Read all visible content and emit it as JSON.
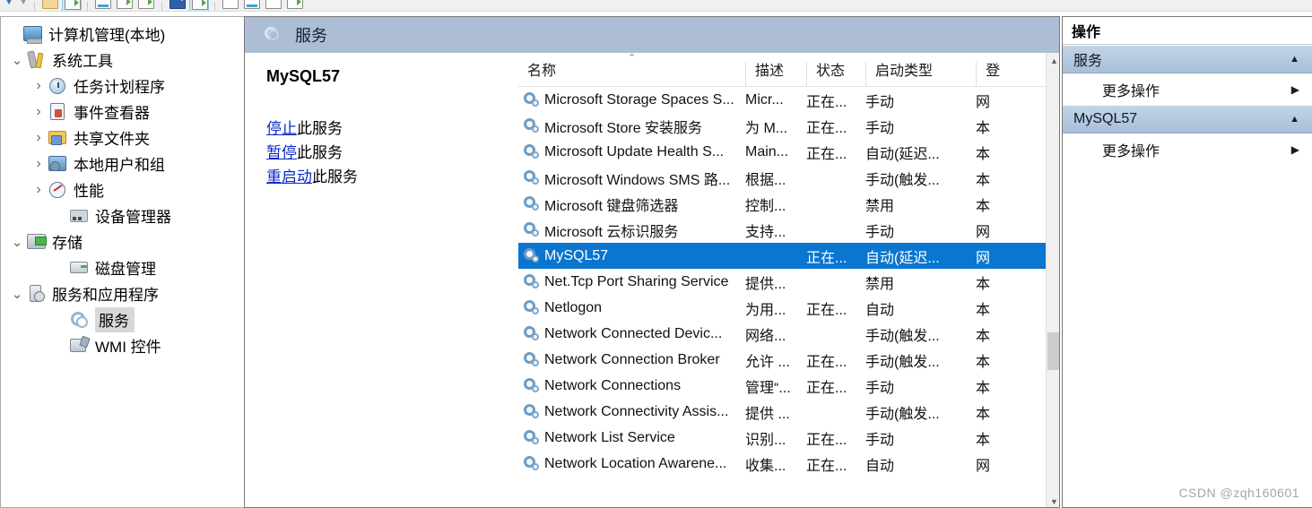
{
  "toolbar": {
    "icons": [
      "back-arrow-icon",
      "forward-arrow-icon",
      "folder-icon",
      "show-hide-tree-icon",
      "properties-icon",
      "export-list-icon",
      "new-window-icon",
      "help-icon",
      "refresh-icon",
      "start-service-icon",
      "stop-service-icon",
      "pause-service-icon",
      "restart-service-icon"
    ]
  },
  "tree": {
    "items": [
      {
        "label": "计算机管理(本地)",
        "icon": "computer-icon",
        "indent": 0,
        "twist": "",
        "selected": false
      },
      {
        "label": "系统工具",
        "icon": "system-tools-icon",
        "indent": 1,
        "twist": "v",
        "selected": false
      },
      {
        "label": "任务计划程序",
        "icon": "task-scheduler-icon",
        "indent": 2,
        "twist": ">",
        "selected": false
      },
      {
        "label": "事件查看器",
        "icon": "event-viewer-icon",
        "indent": 2,
        "twist": ">",
        "selected": false
      },
      {
        "label": "共享文件夹",
        "icon": "shared-folders-icon",
        "indent": 2,
        "twist": ">",
        "selected": false
      },
      {
        "label": "本地用户和组",
        "icon": "local-users-groups-icon",
        "indent": 2,
        "twist": ">",
        "selected": false
      },
      {
        "label": "性能",
        "icon": "performance-icon",
        "indent": 2,
        "twist": ">",
        "selected": false
      },
      {
        "label": "设备管理器",
        "icon": "device-manager-icon",
        "indent": 3,
        "twist": "",
        "selected": false
      },
      {
        "label": "存储",
        "icon": "storage-icon",
        "indent": 1,
        "twist": "v",
        "selected": false
      },
      {
        "label": "磁盘管理",
        "icon": "disk-management-icon",
        "indent": 3,
        "twist": "",
        "selected": false
      },
      {
        "label": "服务和应用程序",
        "icon": "services-applications-icon",
        "indent": 1,
        "twist": "v",
        "selected": false
      },
      {
        "label": "服务",
        "icon": "services-gear-icon",
        "indent": 3,
        "twist": "",
        "selected": true
      },
      {
        "label": "WMI 控件",
        "icon": "wmi-control-icon",
        "indent": 3,
        "twist": "",
        "selected": false
      }
    ]
  },
  "console": {
    "header_title": "服务",
    "header_icon": "services-gear-icon"
  },
  "detail": {
    "service_name": "MySQL57",
    "links": [
      {
        "link": "停止",
        "suffix": "此服务"
      },
      {
        "link": "暂停",
        "suffix": "此服务"
      },
      {
        "link": "重启动",
        "suffix": "此服务"
      }
    ]
  },
  "list": {
    "columns": [
      {
        "key": "name",
        "label": "名称",
        "sorted": "asc"
      },
      {
        "key": "desc",
        "label": "描述",
        "sorted": ""
      },
      {
        "key": "state",
        "label": "状态",
        "sorted": ""
      },
      {
        "key": "start",
        "label": "启动类型",
        "sorted": ""
      },
      {
        "key": "logon",
        "label": "登",
        "sorted": ""
      }
    ],
    "rows": [
      {
        "name": "Microsoft Storage Spaces S...",
        "desc": "Micr...",
        "state": "正在...",
        "start": "手动",
        "logon": "网",
        "selected": false
      },
      {
        "name": "Microsoft Store 安装服务",
        "desc": "为 M...",
        "state": "正在...",
        "start": "手动",
        "logon": "本",
        "selected": false
      },
      {
        "name": "Microsoft Update Health S...",
        "desc": "Main...",
        "state": "正在...",
        "start": "自动(延迟...",
        "logon": "本",
        "selected": false
      },
      {
        "name": "Microsoft Windows SMS 路...",
        "desc": "根据...",
        "state": "",
        "start": "手动(触发...",
        "logon": "本",
        "selected": false
      },
      {
        "name": "Microsoft 键盘筛选器",
        "desc": "控制...",
        "state": "",
        "start": "禁用",
        "logon": "本",
        "selected": false
      },
      {
        "name": "Microsoft 云标识服务",
        "desc": "支持...",
        "state": "",
        "start": "手动",
        "logon": "网",
        "selected": false
      },
      {
        "name": "MySQL57",
        "desc": "",
        "state": "正在...",
        "start": "自动(延迟...",
        "logon": "网",
        "selected": true
      },
      {
        "name": "Net.Tcp Port Sharing Service",
        "desc": "提供...",
        "state": "",
        "start": "禁用",
        "logon": "本",
        "selected": false
      },
      {
        "name": "Netlogon",
        "desc": "为用...",
        "state": "正在...",
        "start": "自动",
        "logon": "本",
        "selected": false
      },
      {
        "name": "Network Connected Devic...",
        "desc": "网络...",
        "state": "",
        "start": "手动(触发...",
        "logon": "本",
        "selected": false
      },
      {
        "name": "Network Connection Broker",
        "desc": "允许 ...",
        "state": "正在...",
        "start": "手动(触发...",
        "logon": "本",
        "selected": false
      },
      {
        "name": "Network Connections",
        "desc": "管理“...",
        "state": "正在...",
        "start": "手动",
        "logon": "本",
        "selected": false
      },
      {
        "name": "Network Connectivity Assis...",
        "desc": "提供 ...",
        "state": "",
        "start": "手动(触发...",
        "logon": "本",
        "selected": false
      },
      {
        "name": "Network List Service",
        "desc": "识别...",
        "state": "正在...",
        "start": "手动",
        "logon": "本",
        "selected": false
      },
      {
        "name": "Network Location Awarene...",
        "desc": "收集...",
        "state": "正在...",
        "start": "自动",
        "logon": "网",
        "selected": false
      }
    ],
    "scroll_up_glyph": "▲",
    "scroll_down_glyph": "▼"
  },
  "actions": {
    "title": "操作",
    "groups": [
      {
        "header": "服务",
        "collapse_glyph": "▲",
        "items": [
          {
            "label": "更多操作",
            "submenu_glyph": "▶"
          }
        ]
      },
      {
        "header": "MySQL57",
        "collapse_glyph": "▲",
        "items": [
          {
            "label": "更多操作",
            "submenu_glyph": "▶"
          }
        ]
      }
    ]
  },
  "watermark": "CSDN @zqh160601",
  "colors": {
    "selection_blue": "#0a76d0",
    "console_header_blue": "#adbdd6",
    "action_group_blue": "#b6c9e1",
    "link_blue": "#0a29c4"
  }
}
